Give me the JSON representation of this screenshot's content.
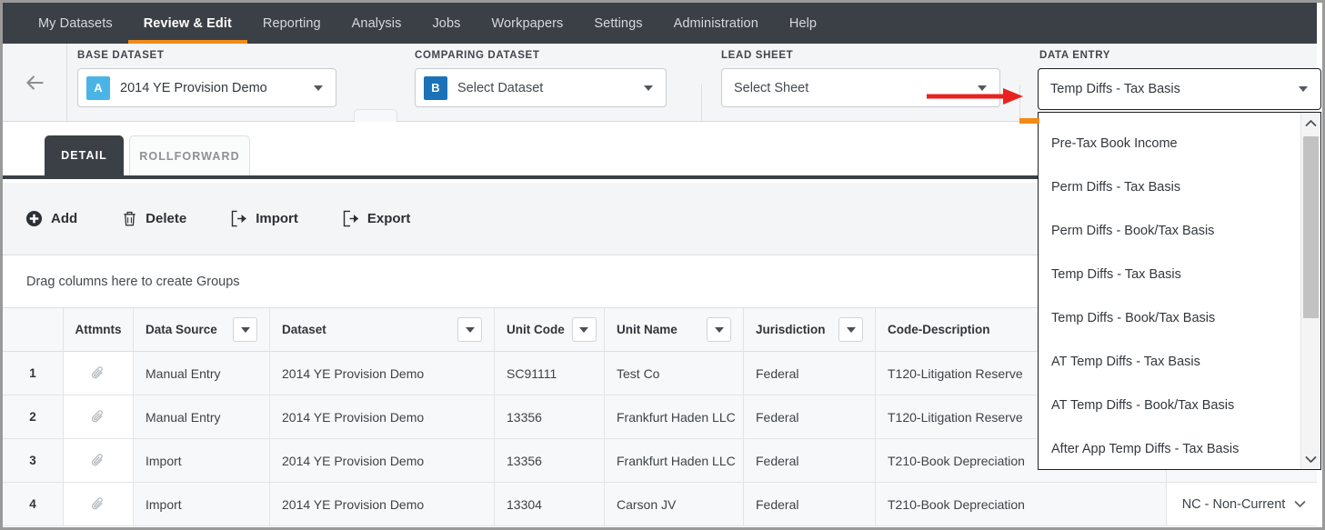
{
  "topnav": {
    "items": [
      {
        "label": "My Datasets",
        "active": false
      },
      {
        "label": "Review & Edit",
        "active": true
      },
      {
        "label": "Reporting",
        "active": false
      },
      {
        "label": "Analysis",
        "active": false
      },
      {
        "label": "Jobs",
        "active": false
      },
      {
        "label": "Workpapers",
        "active": false
      },
      {
        "label": "Settings",
        "active": false
      },
      {
        "label": "Administration",
        "active": false
      },
      {
        "label": "Help",
        "active": false
      }
    ],
    "accent_color": "#f28a18",
    "bg_color": "#3b4046"
  },
  "dataset_bar": {
    "back_icon": "back-arrow-icon",
    "base": {
      "label": "BASE DATASET",
      "badge": "A",
      "badge_color": "#4ab4e6",
      "value": "2014 YE Provision Demo"
    },
    "compare_icon": "compare-datasets-icon",
    "comparing": {
      "label": "COMPARING DATASET",
      "badge": "B",
      "badge_color": "#1b72b8",
      "value": "Select Dataset"
    },
    "lead_sheet": {
      "label": "LEAD SHEET",
      "value": "Select Sheet"
    },
    "data_entry": {
      "label": "DATA ENTRY",
      "value": "Temp Diffs - Tax Basis"
    },
    "annotation": {
      "type": "red-arrow",
      "color": "#e8231f"
    }
  },
  "tabs": [
    {
      "label": "DETAIL",
      "active": true
    },
    {
      "label": "ROLLFORWARD",
      "active": false
    }
  ],
  "toolbar": {
    "buttons": [
      {
        "label": "Add",
        "icon": "plus-circle-icon"
      },
      {
        "label": "Delete",
        "icon": "trash-icon"
      },
      {
        "label": "Import",
        "icon": "import-icon"
      },
      {
        "label": "Export",
        "icon": "export-icon"
      }
    ]
  },
  "group_panel": {
    "hint": "Drag columns here to create Groups"
  },
  "grid": {
    "columns": [
      {
        "header": "",
        "key": "rownum",
        "filter": false
      },
      {
        "header": "Attmnts",
        "key": "attm",
        "filter": false
      },
      {
        "header": "Data Source",
        "key": "source",
        "filter": true
      },
      {
        "header": "Dataset",
        "key": "dataset",
        "filter": true
      },
      {
        "header": "Unit Code",
        "key": "unit_code",
        "filter": true
      },
      {
        "header": "Unit Name",
        "key": "unit_name",
        "filter": true
      },
      {
        "header": "Jurisdiction",
        "key": "jurisdiction",
        "filter": true
      },
      {
        "header": "Code-Description",
        "key": "code_desc",
        "filter": false
      },
      {
        "header": "",
        "key": "extra",
        "filter": false
      }
    ],
    "attachment_icon": "paperclip-icon",
    "rows": [
      {
        "rownum": "1",
        "source": "Manual Entry",
        "dataset": "2014 YE Provision Demo",
        "unit_code": "SC91111",
        "unit_name": "Test Co",
        "jurisdiction": "Federal",
        "code_desc": "T120-Litigation Reserve",
        "extra": ""
      },
      {
        "rownum": "2",
        "source": "Manual Entry",
        "dataset": "2014 YE Provision Demo",
        "unit_code": "13356",
        "unit_name": "Frankfurt Haden LLC",
        "jurisdiction": "Federal",
        "code_desc": "T120-Litigation Reserve",
        "extra": ""
      },
      {
        "rownum": "3",
        "source": "Import",
        "dataset": "2014 YE Provision Demo",
        "unit_code": "13356",
        "unit_name": "Frankfurt Haden LLC",
        "jurisdiction": "Federal",
        "code_desc": "T210-Book Depreciation",
        "extra": ""
      },
      {
        "rownum": "4",
        "source": "Import",
        "dataset": "2014 YE Provision Demo",
        "unit_code": "13304",
        "unit_name": "Carson JV",
        "jurisdiction": "Federal",
        "code_desc": "T210-Book Depreciation",
        "extra": "NC - Non-Current"
      }
    ]
  },
  "dropdown": {
    "selected": "Temp Diffs - Tax Basis",
    "open": true,
    "options": [
      "Pre-Tax Book Income",
      "Perm Diffs - Tax Basis",
      "Perm Diffs - Book/Tax Basis",
      "Temp Diffs - Tax Basis",
      "Temp Diffs - Book/Tax Basis",
      "AT Temp Diffs - Tax Basis",
      "AT Temp Diffs - Book/Tax Basis",
      "After App Temp Diffs - Tax Basis"
    ]
  }
}
